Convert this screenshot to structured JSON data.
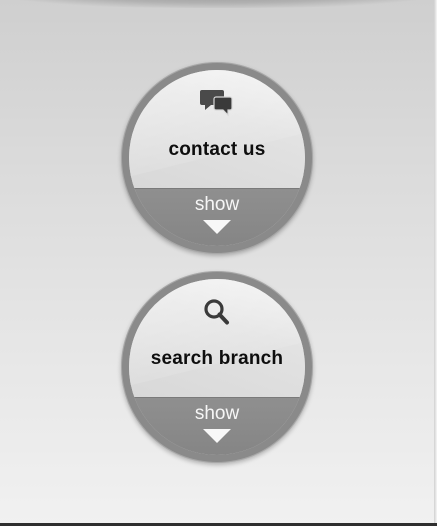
{
  "buttons": [
    {
      "label": "contact us",
      "toggle": "show",
      "icon": "chat-bubbles-icon"
    },
    {
      "label": "search branch",
      "toggle": "show",
      "icon": "search-icon"
    }
  ]
}
